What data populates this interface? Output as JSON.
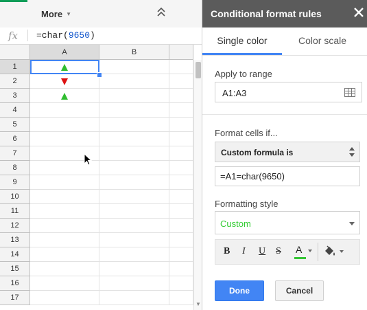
{
  "toolbar": {
    "more_label": "More"
  },
  "formula_bar": {
    "fx": "fx",
    "formula_prefix": "=char(",
    "formula_number": "9650",
    "formula_suffix": ")"
  },
  "sheet": {
    "columns": [
      "A",
      "B"
    ],
    "rows": [
      "1",
      "2",
      "3",
      "4",
      "5",
      "6",
      "7",
      "8",
      "9",
      "10",
      "11",
      "12",
      "13",
      "14",
      "15",
      "16",
      "17"
    ],
    "cells": [
      {
        "row": 1,
        "col": "A",
        "symbol": "up",
        "color": "#2fbd2f"
      },
      {
        "row": 2,
        "col": "A",
        "symbol": "down",
        "color": "#dd1111"
      },
      {
        "row": 3,
        "col": "A",
        "symbol": "up",
        "color": "#2fbd2f"
      }
    ],
    "selected_cell": "A1"
  },
  "panel": {
    "title": "Conditional format rules",
    "tabs": [
      {
        "label": "Single color",
        "active": true
      },
      {
        "label": "Color scale",
        "active": false
      }
    ],
    "apply_to_range_label": "Apply to range",
    "range_value": "A1:A3",
    "format_cells_if_label": "Format cells if...",
    "condition": "Custom formula is",
    "formula_value": "=A1=char(9650)",
    "formatting_style_label": "Formatting style",
    "style_value": "Custom",
    "style_color": "#33cc33",
    "format_buttons": {
      "bold": "B",
      "italic": "I",
      "underline": "U",
      "strike": "S",
      "text_color": "A"
    },
    "text_color_swatch": "#34c534",
    "done_label": "Done",
    "cancel_label": "Cancel"
  }
}
